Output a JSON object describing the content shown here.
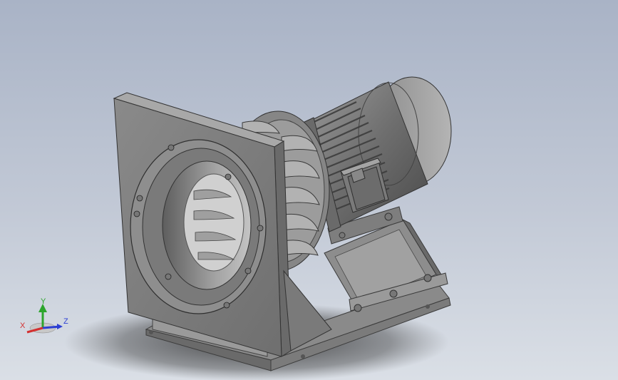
{
  "viewport": {
    "background_top": "#a9b3c6",
    "background_bottom": "#dadfe6"
  },
  "model": {
    "parts": [
      "housing-plate",
      "inlet-flange",
      "impeller",
      "motor",
      "terminal-box",
      "motor-support",
      "base-frame"
    ]
  },
  "triad": {
    "x_label": "X",
    "y_label": "Y",
    "z_label": "Z",
    "colors": {
      "x": "#d33030",
      "y": "#2ca52c",
      "z": "#2c3fd3"
    }
  }
}
